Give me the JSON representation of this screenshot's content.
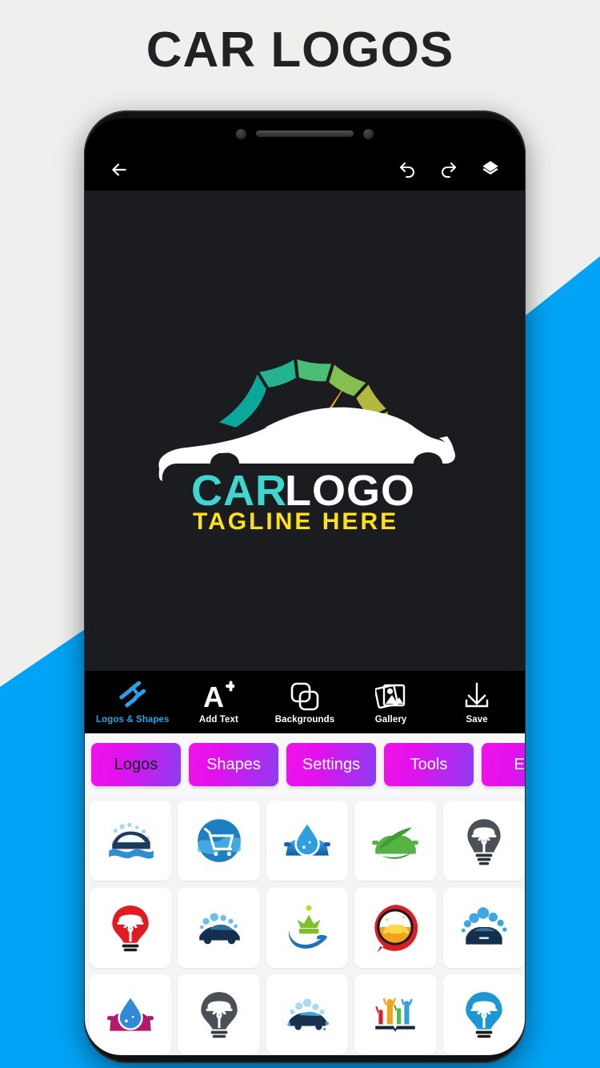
{
  "page": {
    "title": "CAR LOGOS",
    "background_color": "#efefee",
    "accent_color": "#00a3f5"
  },
  "app_bar": {
    "back_icon": "back-arrow-icon",
    "undo_icon": "undo-icon",
    "redo_icon": "redo-icon",
    "layers_icon": "layers-icon"
  },
  "canvas": {
    "background_color": "#1a1c20",
    "logo": {
      "primary_text": "CAR",
      "primary_color": "#3fd6cf",
      "secondary_text": "LOGO",
      "secondary_color": "#ffffff",
      "tagline_text": "TAGLINE HERE",
      "tagline_color": "#ffe11a",
      "car_color": "#ffffff",
      "gauge_colors": [
        "#0aa79b",
        "#2bb98a",
        "#5cc071",
        "#8cc152",
        "#b8bc3e",
        "#d4ab2e"
      ],
      "needle_color": "#f5a623"
    }
  },
  "toolbar": {
    "items": [
      {
        "label": "Logos & Shapes",
        "icon": "pinwheel-shapes-icon",
        "active": true
      },
      {
        "label": "Add Text",
        "icon": "add-text-icon",
        "active": false
      },
      {
        "label": "Backgrounds",
        "icon": "backgrounds-icon",
        "active": false
      },
      {
        "label": "Gallery",
        "icon": "gallery-icon",
        "active": false
      },
      {
        "label": "Save",
        "icon": "save-download-icon",
        "active": false
      }
    ]
  },
  "tabs": {
    "items": [
      {
        "label": "Logos",
        "active": true
      },
      {
        "label": "Shapes",
        "active": false
      },
      {
        "label": "Settings",
        "active": false
      },
      {
        "label": "Tools",
        "active": false
      },
      {
        "label": "Era",
        "active": false
      }
    ]
  },
  "logo_grid": {
    "items": [
      {
        "name": "car-wash-wave-logo",
        "colors": [
          "#1b3a5c",
          "#2e8fd0",
          "#b9e2f5"
        ]
      },
      {
        "name": "cart-circle-logo",
        "colors": [
          "#1e7fc0",
          "#4fb6e8",
          "#ffffff"
        ]
      },
      {
        "name": "water-drop-car-logo",
        "colors": [
          "#1356a8",
          "#2f9fe0",
          "#ffffff"
        ]
      },
      {
        "name": "green-leaf-car-logo",
        "colors": [
          "#56b245",
          "#3f9b32",
          "#ffffff"
        ]
      },
      {
        "name": "bulb-car-dark-logo",
        "colors": [
          "#4b5057",
          "#2e3238",
          "#ffffff"
        ]
      },
      {
        "name": "bulb-car-red-logo",
        "colors": [
          "#e01b22",
          "#b8151b",
          "#ffffff"
        ]
      },
      {
        "name": "blue-car-bubbles-logo",
        "colors": [
          "#13304f",
          "#2f9fe0",
          "#9fd8f2"
        ]
      },
      {
        "name": "crown-hand-logo",
        "colors": [
          "#7ec02a",
          "#1f72b8",
          "#ffd600"
        ]
      },
      {
        "name": "car-circle-orange-logo",
        "colors": [
          "#d81f26",
          "#f7a01b",
          "#ffd84a"
        ]
      },
      {
        "name": "car-foam-bubbles-logo",
        "colors": [
          "#14304f",
          "#3fa6e0",
          "#8fd0ee"
        ]
      },
      {
        "name": "drop-car-magenta-logo",
        "colors": [
          "#b3196c",
          "#2f8ad8",
          "#7fc6ee"
        ]
      },
      {
        "name": "bulb-car-grey-logo",
        "colors": [
          "#4b5057",
          "#343a40",
          "#ffffff"
        ]
      },
      {
        "name": "car-splash-logo",
        "colors": [
          "#16324f",
          "#3da2dd",
          "#a8dbf2"
        ]
      },
      {
        "name": "hands-book-logo",
        "colors": [
          "#d6202a",
          "#f0a31b",
          "#53b945",
          "#2f9fe0"
        ]
      },
      {
        "name": "bulb-car-blue-logo",
        "colors": [
          "#1d96d6",
          "#1477b5",
          "#ffffff"
        ]
      }
    ]
  }
}
